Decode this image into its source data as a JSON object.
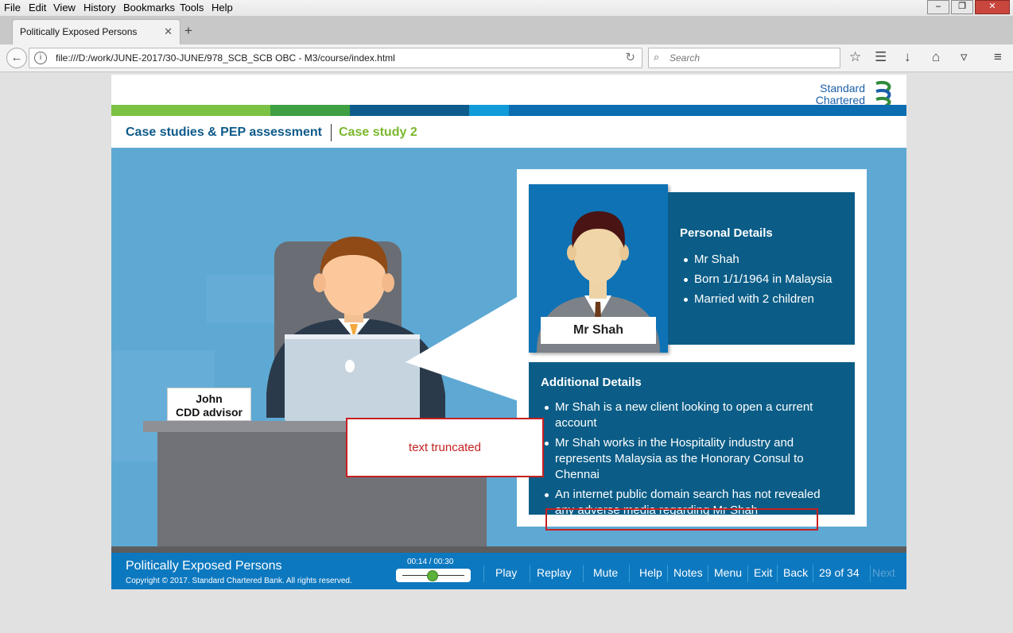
{
  "browser": {
    "menu": [
      "File",
      "Edit",
      "View",
      "History",
      "Bookmarks",
      "Tools",
      "Help"
    ],
    "tab_title": "Politically Exposed Persons",
    "url": "file:///D:/work/JUNE-2017/30-JUNE/978_SCB_SCB OBC - M3/course/index.html",
    "search_placeholder": "Search"
  },
  "header": {
    "logo_line1": "Standard",
    "logo_line2": "Chartered",
    "section": "Case studies & PEP assessment",
    "subsection": "Case study 2",
    "stripe_colors": [
      "#7bc143",
      "#3ea042",
      "#0d5c8c",
      "#119bd8",
      "#0c6db1"
    ]
  },
  "profile": {
    "name": "Mr Shah",
    "personal_title": "Personal Details",
    "personal_items": [
      "Mr Shah",
      "Born 1/1/1964 in Malaysia",
      "Married with 2 children"
    ],
    "additional_title": "Additional Details",
    "additional_items": [
      "Mr Shah is a new client looking to open a current account",
      "Mr Shah works in the Hospitality industry and represents Malaysia as the Honorary Consul to Chennai",
      "An internet public domain search has not revealed any adverse media regarding Mr Shah"
    ]
  },
  "advisor": {
    "name": "John",
    "role": "CDD advisor"
  },
  "annotation": {
    "note": "text truncated",
    "color": "#c62020"
  },
  "footer": {
    "title": "Politically Exposed Persons",
    "copyright": "Copyright © 2017. Standard Chartered Bank. All rights reserved.",
    "time": "00:14 / 00:30",
    "progress": 0.47,
    "buttons": [
      "Play",
      "Replay",
      "Mute",
      "Help",
      "Notes",
      "Menu",
      "Exit",
      "Back"
    ],
    "page_counter": "29 of 34",
    "next_label": "Next",
    "next_enabled": false
  }
}
